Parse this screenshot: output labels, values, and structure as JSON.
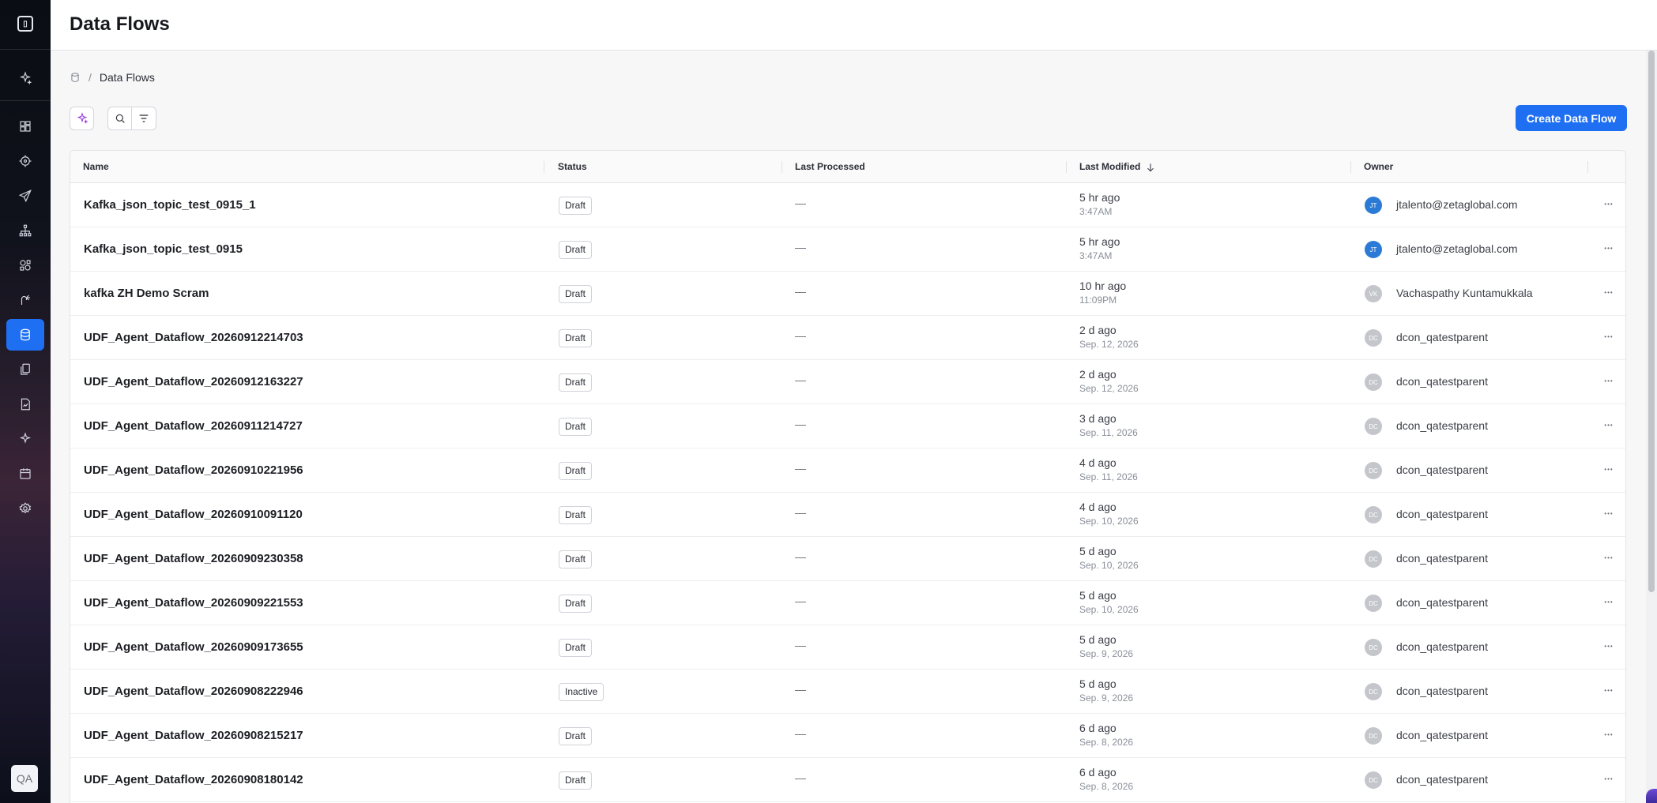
{
  "app": {
    "title": "Data Flows",
    "user_initials": "QA"
  },
  "sidebar": {
    "items": [
      {
        "icon": "sparkle-icon",
        "label": "AI"
      },
      {
        "icon": "dashboard-icon",
        "label": "Dashboard"
      },
      {
        "icon": "target-icon",
        "label": "Audiences"
      },
      {
        "icon": "send-icon",
        "label": "Campaigns"
      },
      {
        "icon": "hierarchy-icon",
        "label": "Journeys"
      },
      {
        "icon": "segments-icon",
        "label": "Segments"
      },
      {
        "icon": "route-icon",
        "label": "Routes"
      },
      {
        "icon": "database-icon",
        "label": "Data Flows",
        "active": true
      },
      {
        "icon": "documents-icon",
        "label": "Content"
      },
      {
        "icon": "report-icon",
        "label": "Reports"
      },
      {
        "icon": "sparkle-icon",
        "label": "Agents"
      },
      {
        "icon": "calendar-icon",
        "label": "Calendar"
      },
      {
        "icon": "gear-icon",
        "label": "Settings"
      }
    ]
  },
  "breadcrumb": {
    "current": "Data Flows",
    "separator": "/"
  },
  "toolbar": {
    "create_label": "Create Data Flow"
  },
  "table": {
    "columns": {
      "name": "Name",
      "status": "Status",
      "last_processed": "Last Processed",
      "last_modified": "Last Modified",
      "owner": "Owner"
    },
    "rows": [
      {
        "name": "Kafka_json_topic_test_0915_1",
        "status": "Draft",
        "processed": "—",
        "modified": "5 hr ago",
        "modified_sub": "3:47AM",
        "owner": "jtalento@zetaglobal.com",
        "initials": "JT",
        "avatar_color": "#2b7bd6"
      },
      {
        "name": "Kafka_json_topic_test_0915",
        "status": "Draft",
        "processed": "—",
        "modified": "5 hr ago",
        "modified_sub": "3:47AM",
        "owner": "jtalento@zetaglobal.com",
        "initials": "JT",
        "avatar_color": "#2b7bd6"
      },
      {
        "name": "kafka ZH Demo Scram",
        "status": "Draft",
        "processed": "—",
        "modified": "10 hr ago",
        "modified_sub": "11:09PM",
        "owner": "Vachaspathy Kuntamukkala",
        "initials": "VK",
        "avatar_color": "#c4c6cb"
      },
      {
        "name": "UDF_Agent_Dataflow_20260912214703",
        "status": "Draft",
        "processed": "—",
        "modified": "2 d ago",
        "modified_sub": "Sep. 12, 2026",
        "owner": "dcon_qatestparent",
        "initials": "DC",
        "avatar_color": "#c4c6cb"
      },
      {
        "name": "UDF_Agent_Dataflow_20260912163227",
        "status": "Draft",
        "processed": "—",
        "modified": "2 d ago",
        "modified_sub": "Sep. 12, 2026",
        "owner": "dcon_qatestparent",
        "initials": "DC",
        "avatar_color": "#c4c6cb"
      },
      {
        "name": "UDF_Agent_Dataflow_20260911214727",
        "status": "Draft",
        "processed": "—",
        "modified": "3 d ago",
        "modified_sub": "Sep. 11, 2026",
        "owner": "dcon_qatestparent",
        "initials": "DC",
        "avatar_color": "#c4c6cb"
      },
      {
        "name": "UDF_Agent_Dataflow_20260910221956",
        "status": "Draft",
        "processed": "—",
        "modified": "4 d ago",
        "modified_sub": "Sep. 11, 2026",
        "owner": "dcon_qatestparent",
        "initials": "DC",
        "avatar_color": "#c4c6cb"
      },
      {
        "name": "UDF_Agent_Dataflow_20260910091120",
        "status": "Draft",
        "processed": "—",
        "modified": "4 d ago",
        "modified_sub": "Sep. 10, 2026",
        "owner": "dcon_qatestparent",
        "initials": "DC",
        "avatar_color": "#c4c6cb"
      },
      {
        "name": "UDF_Agent_Dataflow_20260909230358",
        "status": "Draft",
        "processed": "—",
        "modified": "5 d ago",
        "modified_sub": "Sep. 10, 2026",
        "owner": "dcon_qatestparent",
        "initials": "DC",
        "avatar_color": "#c4c6cb"
      },
      {
        "name": "UDF_Agent_Dataflow_20260909221553",
        "status": "Draft",
        "processed": "—",
        "modified": "5 d ago",
        "modified_sub": "Sep. 10, 2026",
        "owner": "dcon_qatestparent",
        "initials": "DC",
        "avatar_color": "#c4c6cb"
      },
      {
        "name": "UDF_Agent_Dataflow_20260909173655",
        "status": "Draft",
        "processed": "—",
        "modified": "5 d ago",
        "modified_sub": "Sep. 9, 2026",
        "owner": "dcon_qatestparent",
        "initials": "DC",
        "avatar_color": "#c4c6cb"
      },
      {
        "name": "UDF_Agent_Dataflow_20260908222946",
        "status": "Inactive",
        "processed": "—",
        "modified": "5 d ago",
        "modified_sub": "Sep. 9, 2026",
        "owner": "dcon_qatestparent",
        "initials": "DC",
        "avatar_color": "#c4c6cb"
      },
      {
        "name": "UDF_Agent_Dataflow_20260908215217",
        "status": "Draft",
        "processed": "—",
        "modified": "6 d ago",
        "modified_sub": "Sep. 8, 2026",
        "owner": "dcon_qatestparent",
        "initials": "DC",
        "avatar_color": "#c4c6cb"
      },
      {
        "name": "UDF_Agent_Dataflow_20260908180142",
        "status": "Draft",
        "processed": "—",
        "modified": "6 d ago",
        "modified_sub": "Sep. 8, 2026",
        "owner": "dcon_qatestparent",
        "initials": "DC",
        "avatar_color": "#c4c6cb"
      }
    ]
  }
}
